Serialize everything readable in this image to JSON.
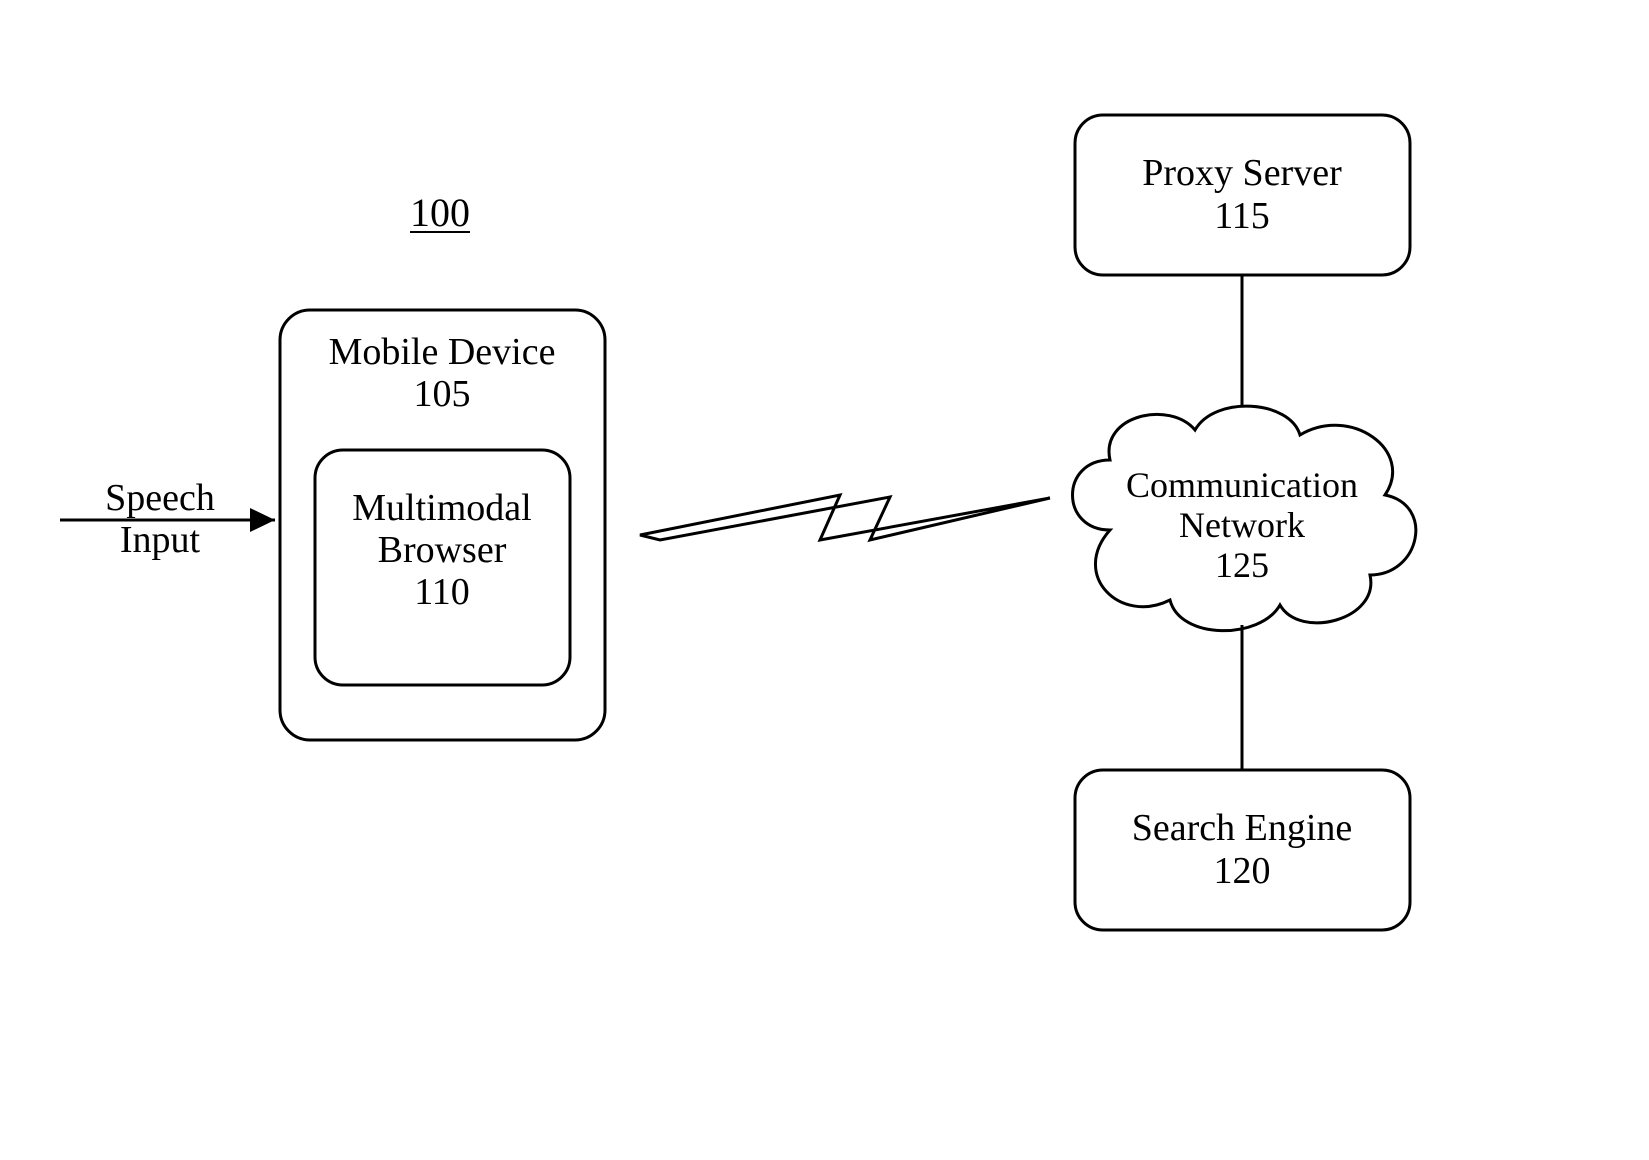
{
  "figure": {
    "reference_number": "100",
    "speech_input_label_line1": "Speech",
    "speech_input_label_line2": "Input",
    "mobile_device": {
      "title": "Mobile Device",
      "ref": "105"
    },
    "multimodal_browser": {
      "title_line1": "Multimodal",
      "title_line2": "Browser",
      "ref": "110"
    },
    "proxy_server": {
      "title": "Proxy Server",
      "ref": "115"
    },
    "communication_network": {
      "title_line1": "Communication",
      "title_line2": "Network",
      "ref": "125"
    },
    "search_engine": {
      "title": "Search Engine",
      "ref": "120"
    }
  }
}
